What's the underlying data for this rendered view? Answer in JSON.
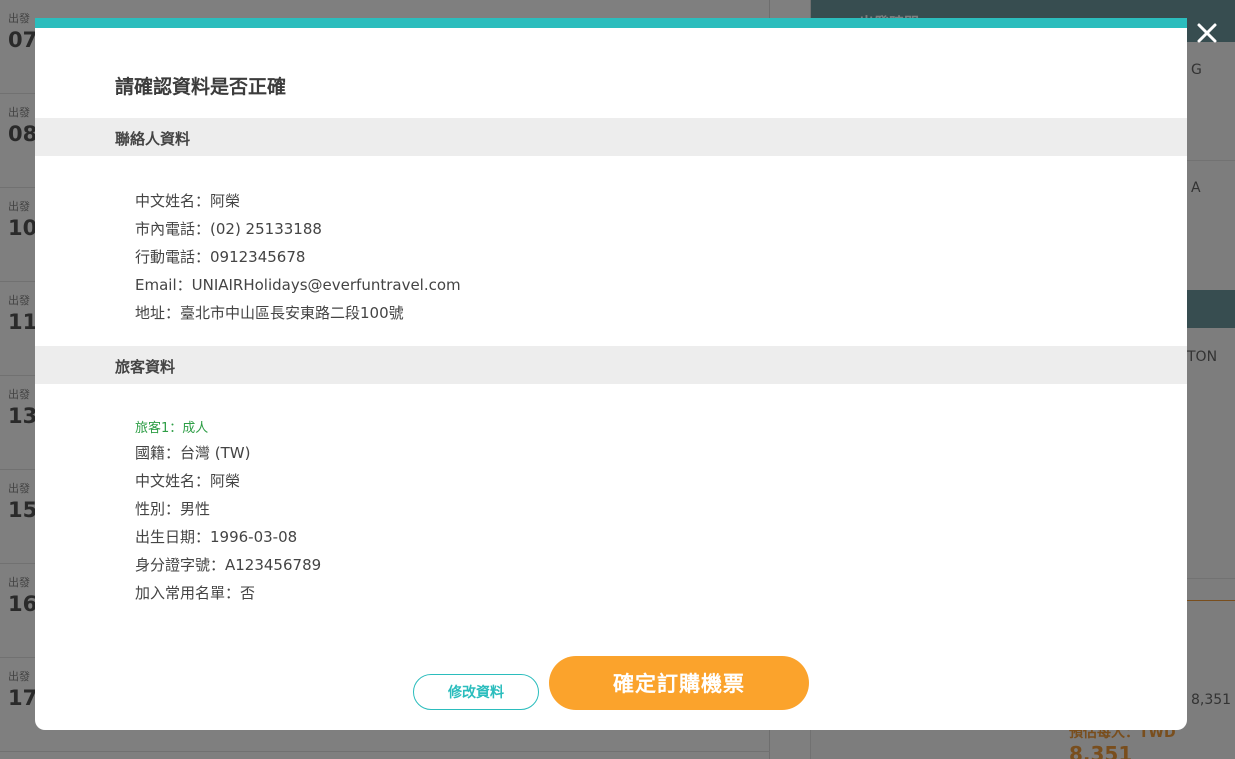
{
  "background": {
    "rows": [
      {
        "label": "出發",
        "time": "07:"
      },
      {
        "label": "出發",
        "time": "08:"
      },
      {
        "label": "出發",
        "time": "10:"
      },
      {
        "label": "出發",
        "time": "11:"
      },
      {
        "label": "出發",
        "time": "13:"
      },
      {
        "label": "出發",
        "time": "15:"
      },
      {
        "label": "出發",
        "time": "16:"
      },
      {
        "label": "出發",
        "time": "17:"
      }
    ],
    "side": {
      "head_title": "出發時間",
      "text_1": "G",
      "text_2": "A",
      "text_3": "TON",
      "price_small": "8,351",
      "price_label": "預估每人：TWD",
      "price_value": "8,351"
    }
  },
  "modal": {
    "title": "請確認資料是否正確",
    "close_icon": "close-icon",
    "contact": {
      "heading": "聯絡人資料",
      "lines": [
        "中文姓名：阿榮",
        "市內電話：(02) 25133188",
        "行動電話：0912345678",
        "Email：UNIAIRHolidays@everfuntravel.com",
        "地址：臺北市中山區長安東路二段100號"
      ]
    },
    "traveler": {
      "heading": "旅客資料",
      "tag": "旅客1：成人",
      "lines": [
        "國籍：台灣 (TW)",
        "中文姓名：阿榮",
        "性別：男性",
        "出生日期：1996-03-08",
        "身分證字號：A123456789",
        "加入常用名單：否"
      ]
    },
    "buttons": {
      "edit_label": "修改資料",
      "confirm_label": "確定訂購機票"
    }
  },
  "colors": {
    "accent_teal": "#2bbdbd",
    "confirm_orange": "#fba32c",
    "traveler_green": "#2e9e46"
  }
}
